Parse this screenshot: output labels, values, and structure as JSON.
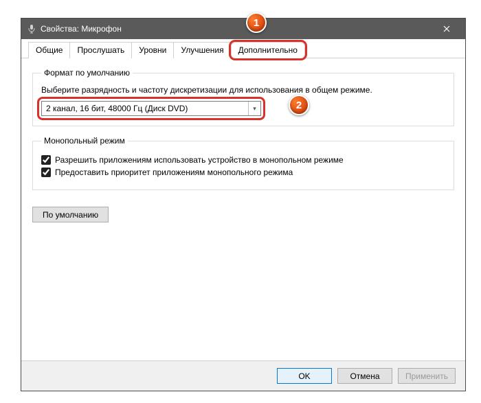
{
  "titlebar": {
    "title": "Свойства: Микрофон"
  },
  "tabs": [
    {
      "label": "Общие"
    },
    {
      "label": "Прослушать"
    },
    {
      "label": "Уровни"
    },
    {
      "label": "Улучшения"
    },
    {
      "label": "Дополнительно"
    }
  ],
  "default_format": {
    "legend": "Формат по умолчанию",
    "help": "Выберите разрядность и частоту дискретизации для использования в общем режиме.",
    "selected": "2 канал, 16 бит, 48000 Гц (Диск DVD)"
  },
  "exclusive": {
    "legend": "Монопольный режим",
    "allow_label": "Разрешить приложениям использовать устройство в монопольном режиме",
    "allow_checked": true,
    "priority_label": "Предоставить приоритет приложениям монопольного режима",
    "priority_checked": true
  },
  "buttons": {
    "restore_defaults": "По умолчанию",
    "ok": "OK",
    "cancel": "Отмена",
    "apply": "Применить"
  },
  "callouts": {
    "one": "1",
    "two": "2"
  }
}
